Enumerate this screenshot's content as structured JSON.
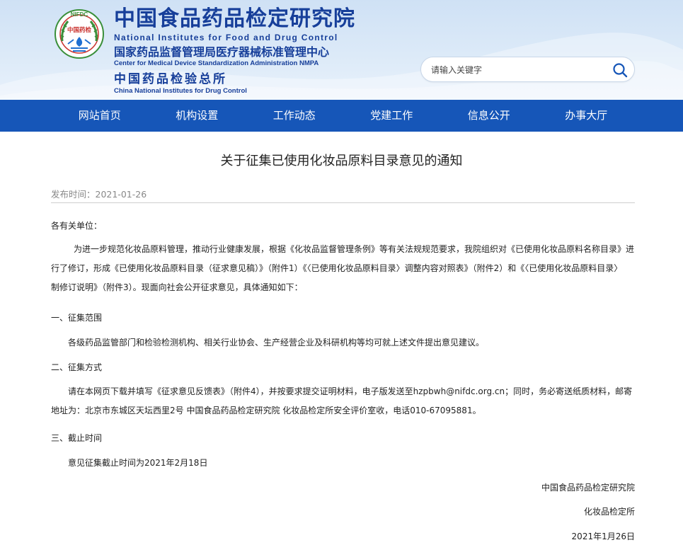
{
  "header": {
    "logo_badge": "NIFDC",
    "logo_inner": "中国药检",
    "title_cn": "中国食品药品检定研究院",
    "title_en": "National Institutes for Food and Drug Control",
    "subtitle_cn": "国家药品监督管理局医疗器械标准管理中心",
    "subtitle_en": "Center for Medical Device Standardization Administration NMPA",
    "third_cn": "中国药品检验总所",
    "third_en": "China National Institutes for Drug Control"
  },
  "search": {
    "placeholder": "请输入关键字"
  },
  "nav": {
    "items": [
      "网站首页",
      "机构设置",
      "工作动态",
      "党建工作",
      "信息公开",
      "办事大厅"
    ]
  },
  "article": {
    "title": "关于征集已使用化妆品原料目录意见的通知",
    "pubdate": "发布时间：2021-01-26",
    "salutation": "各有关单位：",
    "intro_l1": "为进一步规范化妆品原料管理，推动行业健康发展，根据《化妆品监督管理条例》等有关法规规范要求，我院组织对《已使用化妆品原料名称目录》进",
    "intro_l2": "行了修订，形成《已使用化妆品原料目录（征求意见稿）》（附件1）《〈已使用化妆品原料目录〉调整内容对照表》（附件2）和《〈已使用化妆品原料目录〉",
    "intro_l3": "制修订说明》（附件3）。现面向社会公开征求意见，具体通知如下：",
    "sec1_title": "一、征集范围",
    "sec1_text": "各级药品监管部门和检验检测机构、相关行业协会、生产经营企业及科研机构等均可就上述文件提出意见建议。",
    "sec2_title": "二、征集方式",
    "sec2_l1": "请在本网页下载并填写《征求意见反馈表》（附件4），并按要求提交证明材料，电子版发送至hzpbwh@nifdc.org.cn；同时，务必寄送纸质材料，邮寄",
    "sec2_l2": "地址为：北京市东城区天坛西里2号 中国食品药品检定研究院 化妆品检定所安全评价室收，电话010-67095881。",
    "sec3_title": "三、截止时间",
    "sec3_text": "意见征集截止时间为2021年2月18日",
    "sign_org": "中国食品药品检定研究院",
    "sign_dept": "化妆品检定所",
    "sign_date": "2021年1月26日"
  }
}
